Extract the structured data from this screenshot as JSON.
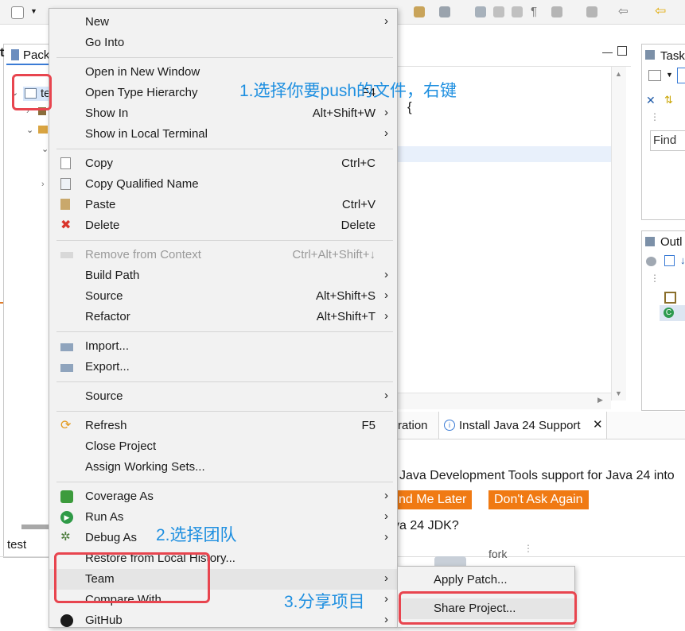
{
  "ide": {
    "package_tab": "Pack",
    "tree_item": "te",
    "task_tab": "Task",
    "find_placeholder": "Find",
    "outline_tab": "Outl",
    "code_brace": "{",
    "bottom_tabs": [
      "ration",
      "Install Java 24 Support"
    ],
    "banner_text": "Java Development Tools support for Java 24 into",
    "remind_later": "nd Me Later",
    "dont_ask": "Don't Ask Again",
    "jdk_text": "va 24 JDK?",
    "status_text": "test",
    "fork_text": "fork"
  },
  "menu": {
    "items": [
      {
        "label": "New",
        "accel": "",
        "submenu": true
      },
      {
        "label": "Go Into",
        "accel": ""
      },
      {
        "label": "Open in New Window",
        "accel": ""
      },
      {
        "label": "Open Type Hierarchy",
        "accel": "F4"
      },
      {
        "label": "Show In",
        "accel": "Alt+Shift+W",
        "submenu": true
      },
      {
        "label": "Show in Local Terminal",
        "accel": "",
        "submenu": true
      },
      {
        "label": "Copy",
        "accel": "Ctrl+C",
        "icon": "copy-icon"
      },
      {
        "label": "Copy Qualified Name",
        "accel": "",
        "icon": "copy-qualified-icon"
      },
      {
        "label": "Paste",
        "accel": "Ctrl+V",
        "icon": "paste-icon"
      },
      {
        "label": "Delete",
        "accel": "Delete",
        "icon": "delete-icon"
      },
      {
        "label": "Remove from Context",
        "accel": "Ctrl+Alt+Shift+↓",
        "disabled": true
      },
      {
        "label": "Build Path",
        "accel": "",
        "submenu": true
      },
      {
        "label": "Source",
        "accel": "Alt+Shift+S",
        "submenu": true
      },
      {
        "label": "Refactor",
        "accel": "Alt+Shift+T",
        "submenu": true
      },
      {
        "label": "Import...",
        "accel": "",
        "icon": "import-icon"
      },
      {
        "label": "Export...",
        "accel": "",
        "icon": "export-icon"
      },
      {
        "label": "Source",
        "accel": "",
        "submenu": true
      },
      {
        "label": "Refresh",
        "accel": "F5",
        "icon": "refresh-icon"
      },
      {
        "label": "Close Project",
        "accel": ""
      },
      {
        "label": "Assign Working Sets...",
        "accel": ""
      },
      {
        "label": "Coverage As",
        "accel": "",
        "submenu": true,
        "icon": "coverage-icon"
      },
      {
        "label": "Run As",
        "accel": "",
        "submenu": true,
        "icon": "run-icon"
      },
      {
        "label": "Debug As",
        "accel": "",
        "submenu": true,
        "icon": "debug-icon"
      },
      {
        "label": "Restore from Local History...",
        "accel": ""
      },
      {
        "label": "Team",
        "accel": "",
        "submenu": true
      },
      {
        "label": "Compare With",
        "accel": "",
        "submenu": true
      },
      {
        "label": "GitHub",
        "accel": "",
        "submenu": true,
        "icon": "github-icon"
      }
    ]
  },
  "submenu": {
    "items": [
      {
        "label": "Apply Patch..."
      },
      {
        "label": "Share Project..."
      }
    ]
  },
  "annotations": {
    "step1": "1.选择你要push的文件，右键",
    "step2": "2.选择团队",
    "step3": "3.分享项目"
  },
  "colors": {
    "annotation_red": "#e8454f",
    "annotation_blue": "#1e8fe0",
    "button_orange": "#f07a13"
  }
}
